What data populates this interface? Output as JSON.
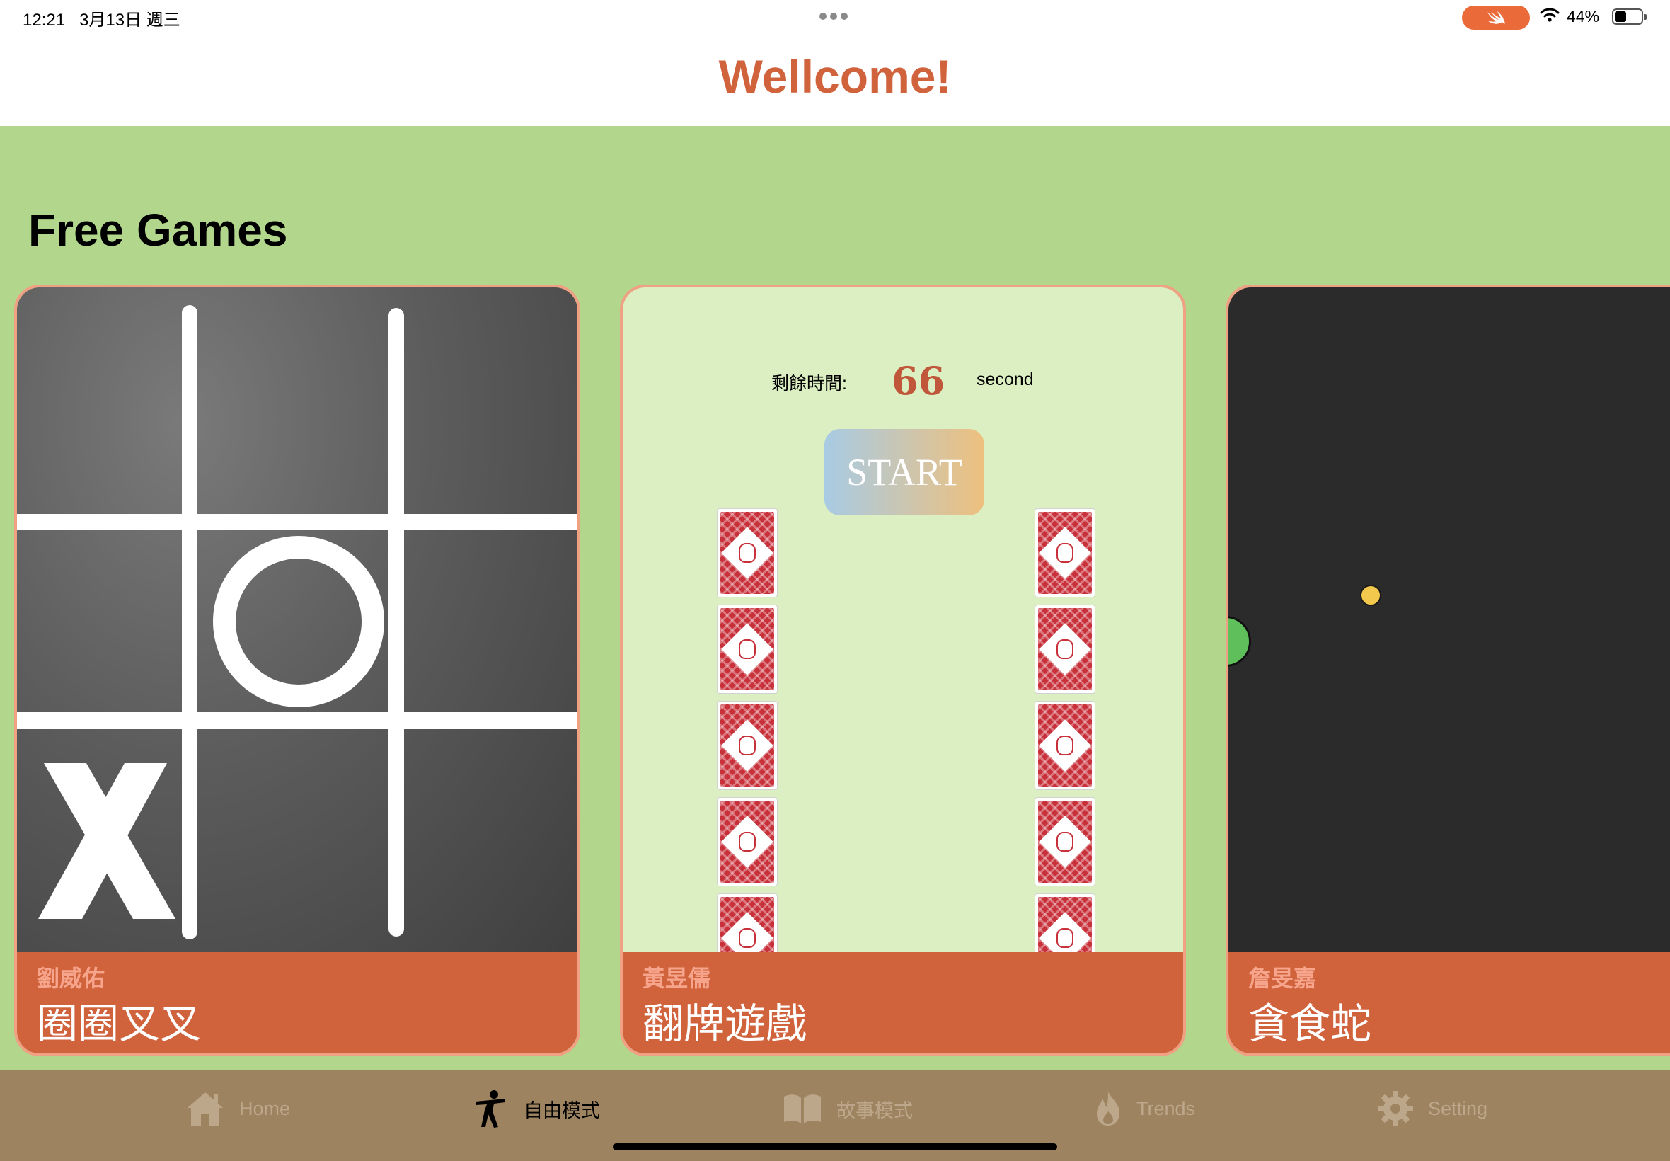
{
  "status_bar": {
    "time": "12:21",
    "date": "3月13日 週三",
    "battery": "44%",
    "battery_level": 0.44,
    "accent": "#ea6a3a"
  },
  "header": {
    "title": "Wellcome!"
  },
  "section": {
    "title": "Free Games"
  },
  "games": [
    {
      "author": "劉威佑",
      "name": "圈圈叉叉",
      "art": "tic-tac-toe"
    },
    {
      "author": "黃昱儒",
      "name": "翻牌遊戲",
      "art": "memory-cards",
      "timer_label": "剩餘時間:",
      "timer_value": "66",
      "timer_unit": "second",
      "start_label": "START"
    },
    {
      "author": "詹旻嘉",
      "name": "貪食蛇",
      "art": "snake"
    }
  ],
  "tabs": [
    {
      "label": "Home",
      "icon": "house-icon",
      "active": false
    },
    {
      "label": "自由模式",
      "icon": "martial-arts-icon",
      "active": true
    },
    {
      "label": "故事模式",
      "icon": "book-icon",
      "active": false
    },
    {
      "label": "Trends",
      "icon": "flame-icon",
      "active": false
    },
    {
      "label": "Setting",
      "icon": "gear-icon",
      "active": false
    }
  ],
  "colors": {
    "accent": "#d0623c",
    "background": "#b2d78c",
    "tab_bar": "#9e8360",
    "card_border": "#f0a184"
  }
}
